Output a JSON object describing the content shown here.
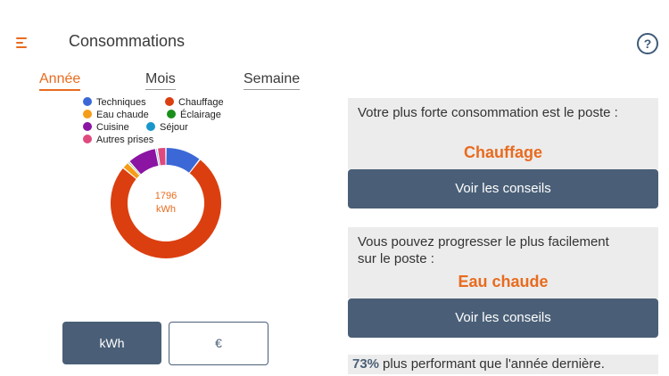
{
  "header": {
    "title": "Consommations",
    "menu_icon": "menu-icon",
    "help_icon": "help-icon",
    "help_symbol": "?"
  },
  "tabs": [
    {
      "label": "Année",
      "active": true
    },
    {
      "label": "Mois",
      "active": false
    },
    {
      "label": "Semaine",
      "active": false
    }
  ],
  "legend": [
    {
      "label": "Techniques",
      "color": "#3b68d6"
    },
    {
      "label": "Chauffage",
      "color": "#db3f10"
    },
    {
      "label": "Eau chaude",
      "color": "#f59d18"
    },
    {
      "label": "Éclairage",
      "color": "#1b8f1b"
    },
    {
      "label": "Cuisine",
      "color": "#8b14a3"
    },
    {
      "label": "Séjour",
      "color": "#1796cc"
    },
    {
      "label": "Autres prises",
      "color": "#df4a7e"
    }
  ],
  "chart_data": {
    "type": "pie",
    "style": "donut",
    "total_value": "1796",
    "total_unit": "kWh",
    "slices": [
      {
        "name": "Techniques",
        "share": 0.105,
        "color": "#3b68d6"
      },
      {
        "name": "Chauffage",
        "share": 0.755,
        "color": "#db3f10"
      },
      {
        "name": "Eau chaude",
        "share": 0.02,
        "color": "#f59d18"
      },
      {
        "name": "Éclairage",
        "share": 0.005,
        "color": "#1b8f1b"
      },
      {
        "name": "Cuisine",
        "share": 0.085,
        "color": "#8b14a3"
      },
      {
        "name": "Séjour",
        "share": 0.005,
        "color": "#1796cc"
      },
      {
        "name": "Autres prises",
        "share": 0.025,
        "color": "#df4a7e"
      }
    ]
  },
  "units": {
    "kwh_label": "kWh",
    "euro_label": "€",
    "selected": "kWh"
  },
  "highest": {
    "text": "Votre plus forte consommation est le poste :",
    "value": "Chauffage",
    "button_label": "Voir les conseils"
  },
  "progress": {
    "text_line1": "Vous pouvez progresser le plus facilement",
    "text_line2": "sur le poste :",
    "value": "Eau chaude",
    "button_label": "Voir les conseils"
  },
  "performance": {
    "percent": "73%",
    "text": "plus performant que l'année dernière."
  },
  "colors": {
    "accent": "#e86b1f",
    "primary": "#4a5f77",
    "panel": "#ececec"
  }
}
